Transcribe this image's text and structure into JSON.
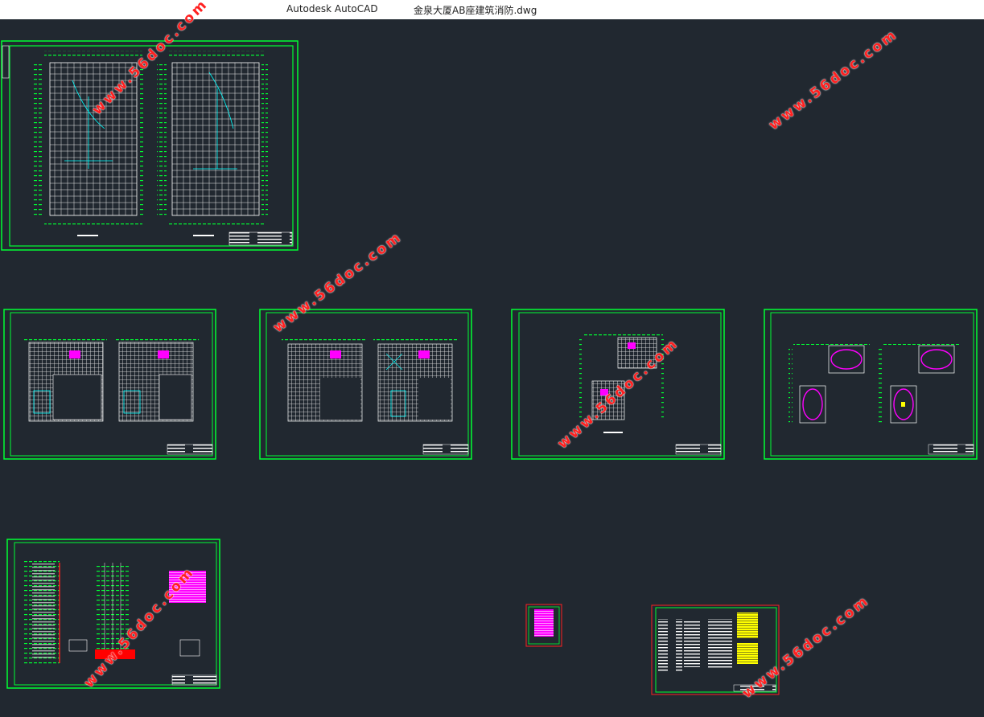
{
  "titlebar": {
    "app_name": "Autodesk AutoCAD",
    "document_name": "金泉大厦AB座建筑消防.dwg",
    "background": "#ffffff"
  },
  "canvas": {
    "background": "#212830",
    "sheet_border_color": "#00ff33",
    "alt_border_color": "#ff2020",
    "drawing_line_color": "#ffffff",
    "accent_colors": [
      "#00ffff",
      "#ff00ff",
      "#ffff00",
      "#ff0000"
    ]
  },
  "sheets": [
    {
      "name": "floor-plans-large",
      "content": "two-building-floor-plans"
    },
    {
      "name": "floor-plans-row-1",
      "content": "two-floor-plans"
    },
    {
      "name": "floor-plans-row-2",
      "content": "two-floor-plans"
    },
    {
      "name": "floor-plans-row-3",
      "content": "two-floor-plans"
    },
    {
      "name": "roof-plans",
      "content": "four-small-plans"
    },
    {
      "name": "system-diagram",
      "content": "riser-diagram"
    },
    {
      "name": "detail-sheet-small",
      "content": "magenta-block"
    },
    {
      "name": "legend-sheet",
      "content": "notes-and-legend"
    }
  ],
  "watermark": {
    "text": "www.56doc.com",
    "color": "#ff2020"
  }
}
